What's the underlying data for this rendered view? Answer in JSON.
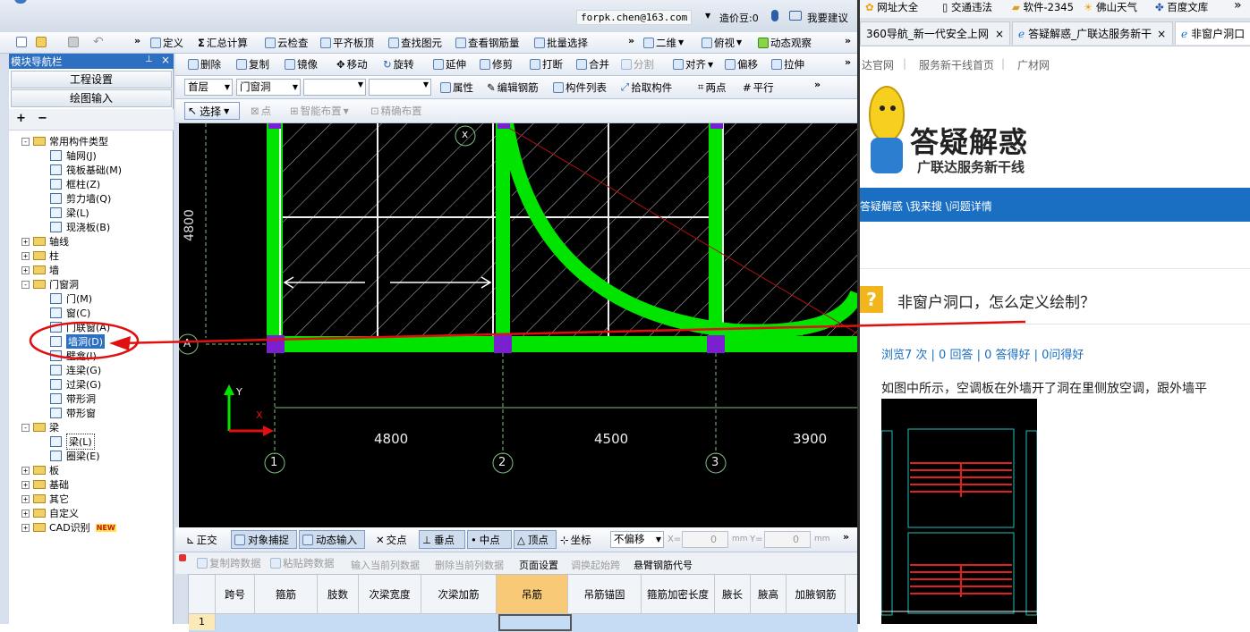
{
  "titlebar": {
    "email": "forpk.chen@163.com",
    "bean": "造价豆:0",
    "suggest": "我要建议"
  },
  "toolbar1": {
    "define": "定义",
    "sum": "汇总计算",
    "cloud": "云检查",
    "flush": "平齐板顶",
    "find": "查找图元",
    "rebar": "查看钢筋量",
    "batch": "批量选择",
    "view2d": "二维",
    "top": "俯视",
    "dynamic": "动态观察"
  },
  "toolbar2": {
    "delete": "删除",
    "copy": "复制",
    "mirror": "镜像",
    "move": "移动",
    "rotate": "旋转",
    "extend": "延伸",
    "trim": "修剪",
    "break": "打断",
    "merge": "合并",
    "split": "分割",
    "align": "对齐",
    "offset": "偏移",
    "stretch": "拉伸"
  },
  "toolbar3": {
    "floor": "首层",
    "category": "门窗洞",
    "props": "属性",
    "edit_rebar": "编辑钢筋",
    "list": "构件列表",
    "pick": "拾取构件",
    "two_points": "两点",
    "parallel": "平行"
  },
  "toolbar4": {
    "select": "选择",
    "point": "点",
    "smart": "智能布置",
    "precise": "精确布置"
  },
  "navigator": {
    "title": "模块导航栏",
    "btn1": "工程设置",
    "btn2": "绘图输入",
    "tree": [
      {
        "label": "常用构件类型",
        "level": 0,
        "kind": "folder",
        "sign": "-"
      },
      {
        "label": "轴网(J)",
        "level": 1,
        "kind": "item"
      },
      {
        "label": "筏板基础(M)",
        "level": 1,
        "kind": "item"
      },
      {
        "label": "框柱(Z)",
        "level": 1,
        "kind": "item"
      },
      {
        "label": "剪力墙(Q)",
        "level": 1,
        "kind": "item"
      },
      {
        "label": "梁(L)",
        "level": 1,
        "kind": "item"
      },
      {
        "label": "现浇板(B)",
        "level": 1,
        "kind": "item"
      },
      {
        "label": "轴线",
        "level": 0,
        "kind": "folder",
        "sign": "+"
      },
      {
        "label": "柱",
        "level": 0,
        "kind": "folder",
        "sign": "+"
      },
      {
        "label": "墙",
        "level": 0,
        "kind": "folder",
        "sign": "+"
      },
      {
        "label": "门窗洞",
        "level": 0,
        "kind": "folder",
        "sign": "-"
      },
      {
        "label": "门(M)",
        "level": 1,
        "kind": "item"
      },
      {
        "label": "窗(C)",
        "level": 1,
        "kind": "item"
      },
      {
        "label": "门联窗(A)",
        "level": 1,
        "kind": "item"
      },
      {
        "label": "墙洞(D)",
        "level": 1,
        "kind": "item",
        "selected": true
      },
      {
        "label": "壁龛(I)",
        "level": 1,
        "kind": "item"
      },
      {
        "label": "连梁(G)",
        "level": 1,
        "kind": "item"
      },
      {
        "label": "过梁(G)",
        "level": 1,
        "kind": "item"
      },
      {
        "label": "带形洞",
        "level": 1,
        "kind": "item"
      },
      {
        "label": "带形窗",
        "level": 1,
        "kind": "item"
      },
      {
        "label": "梁",
        "level": 0,
        "kind": "folder",
        "sign": "-"
      },
      {
        "label": "梁(L)",
        "level": 1,
        "kind": "item",
        "boxed": true
      },
      {
        "label": "圈梁(E)",
        "level": 1,
        "kind": "item"
      },
      {
        "label": "板",
        "level": 0,
        "kind": "folder",
        "sign": "+"
      },
      {
        "label": "基础",
        "level": 0,
        "kind": "folder",
        "sign": "+"
      },
      {
        "label": "其它",
        "level": 0,
        "kind": "folder",
        "sign": "+"
      },
      {
        "label": "自定义",
        "level": 0,
        "kind": "folder",
        "sign": "+"
      },
      {
        "label": "CAD识别",
        "level": 0,
        "kind": "folder",
        "sign": "+",
        "badge": "NEW"
      }
    ]
  },
  "canvas": {
    "dim_vertical": "4800",
    "dims": [
      "4800",
      "4500",
      "3900"
    ],
    "axes": [
      "1",
      "2",
      "3"
    ],
    "axis_a": "A",
    "axis_x": "X",
    "axis_y": "Y",
    "marker": "x"
  },
  "snapbar": {
    "ortho": "正交",
    "snap": "对象捕捉",
    "dyn": "动态输入",
    "intersect": "交点",
    "perp": "垂点",
    "mid": "中点",
    "vertex": "顶点",
    "coord": "坐标",
    "offset": "不偏移",
    "x_label": "X=",
    "x_val": "0",
    "mm1": "mm",
    "y_label": "Y=",
    "y_val": "0",
    "mm2": "mm"
  },
  "gridbar": {
    "copy": "复制跨数据",
    "paste": "粘贴跨数据",
    "input": "输入当前列数据",
    "clear": "删除当前列数据",
    "page": "页面设置",
    "swap": "调换起始跨",
    "cant": "悬臂钢筋代号"
  },
  "grid": {
    "headers": [
      "跨号",
      "箍筋",
      "肢数",
      "次梁宽度",
      "次梁加筋",
      "吊筋",
      "吊筋锚固",
      "箍筋加密长度",
      "腋长",
      "腋高",
      "加腋钢筋"
    ],
    "row1": "1"
  },
  "browser": {
    "favorites": [
      "网址大全",
      "交通违法",
      "软件-2345",
      "佛山天气",
      "百度文库"
    ],
    "tabs": [
      "360导航_新一代安全上网",
      "答疑解惑_广联达服务新干",
      "非窗户洞口"
    ],
    "links": [
      "达官网",
      "服务新干线首页",
      "广材网"
    ],
    "logo_main": "答疑解惑",
    "logo_sub": "广联达服务新干线",
    "breadcrumb": "答疑解惑 \\我来搜 \\问题详情",
    "question": "非窗户洞口，怎么定义绘制？",
    "stats": "浏览7 次 | 0 回答 | 0 答得好 | 0问得好",
    "desc": "如图中所示，空调板在外墙开了洞在里侧放空调，跟外墙平"
  },
  "colors": {
    "accent": "#1a73c8",
    "green": "#00e400",
    "red": "#e01010",
    "purple": "#7a1fd0",
    "nav_blue": "#2d6fc0"
  }
}
